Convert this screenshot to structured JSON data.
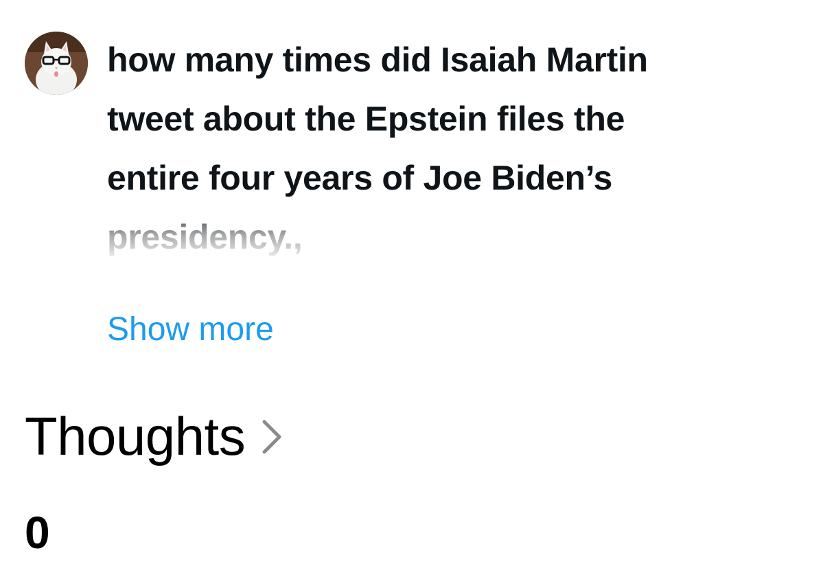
{
  "message": {
    "avatar_icon": "cat-with-glasses-avatar",
    "text_lines": [
      "how many times did Isaiah Martin",
      "tweet about the Epstein files the",
      "entire four years of Joe Biden’s",
      "presidency.,"
    ],
    "show_more_label": "Show more",
    "link_color": "#1d9bf0"
  },
  "thoughts": {
    "label": "Thoughts",
    "chevron_icon": "chevron-right-icon"
  },
  "result": {
    "value": "0"
  }
}
